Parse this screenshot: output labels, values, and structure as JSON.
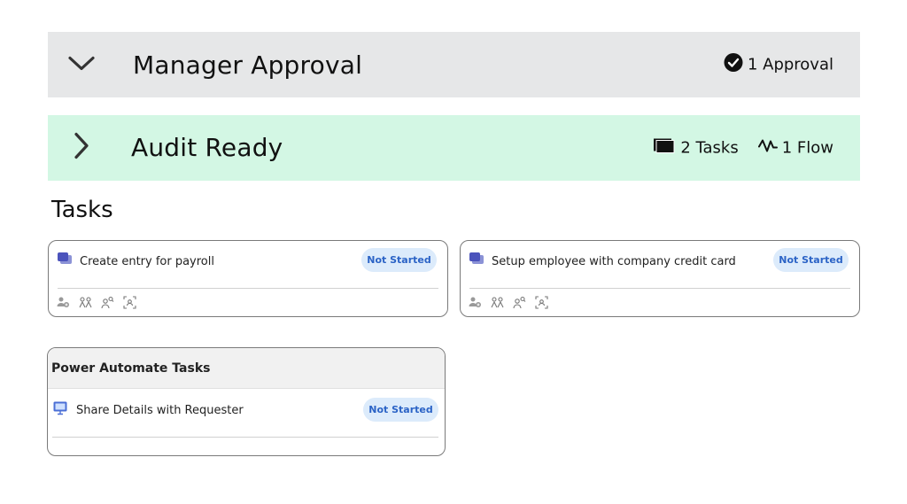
{
  "stages": {
    "approval": {
      "title": "Manager Approval",
      "count_label": "1 Approval",
      "expanded": true
    },
    "audit": {
      "title": "Audit Ready",
      "tasks_label": "2 Tasks",
      "flow_label": "1 Flow",
      "expanded": false
    }
  },
  "tasks_heading": "Tasks",
  "tasks": [
    {
      "label": "Create entry for payroll",
      "status": "Not Started"
    },
    {
      "label": "Setup employee with company credit card",
      "status": "Not Started"
    }
  ],
  "flow_section": {
    "heading": "Power Automate Tasks",
    "items": [
      {
        "label": "Share Details with Requester",
        "status": "Not Started"
      }
    ]
  },
  "colors": {
    "approval_bar": "#e6e7e8",
    "audit_bar": "#d3f7e4",
    "status_pill_bg": "#dcebfb",
    "status_pill_text": "#2b63c6"
  }
}
